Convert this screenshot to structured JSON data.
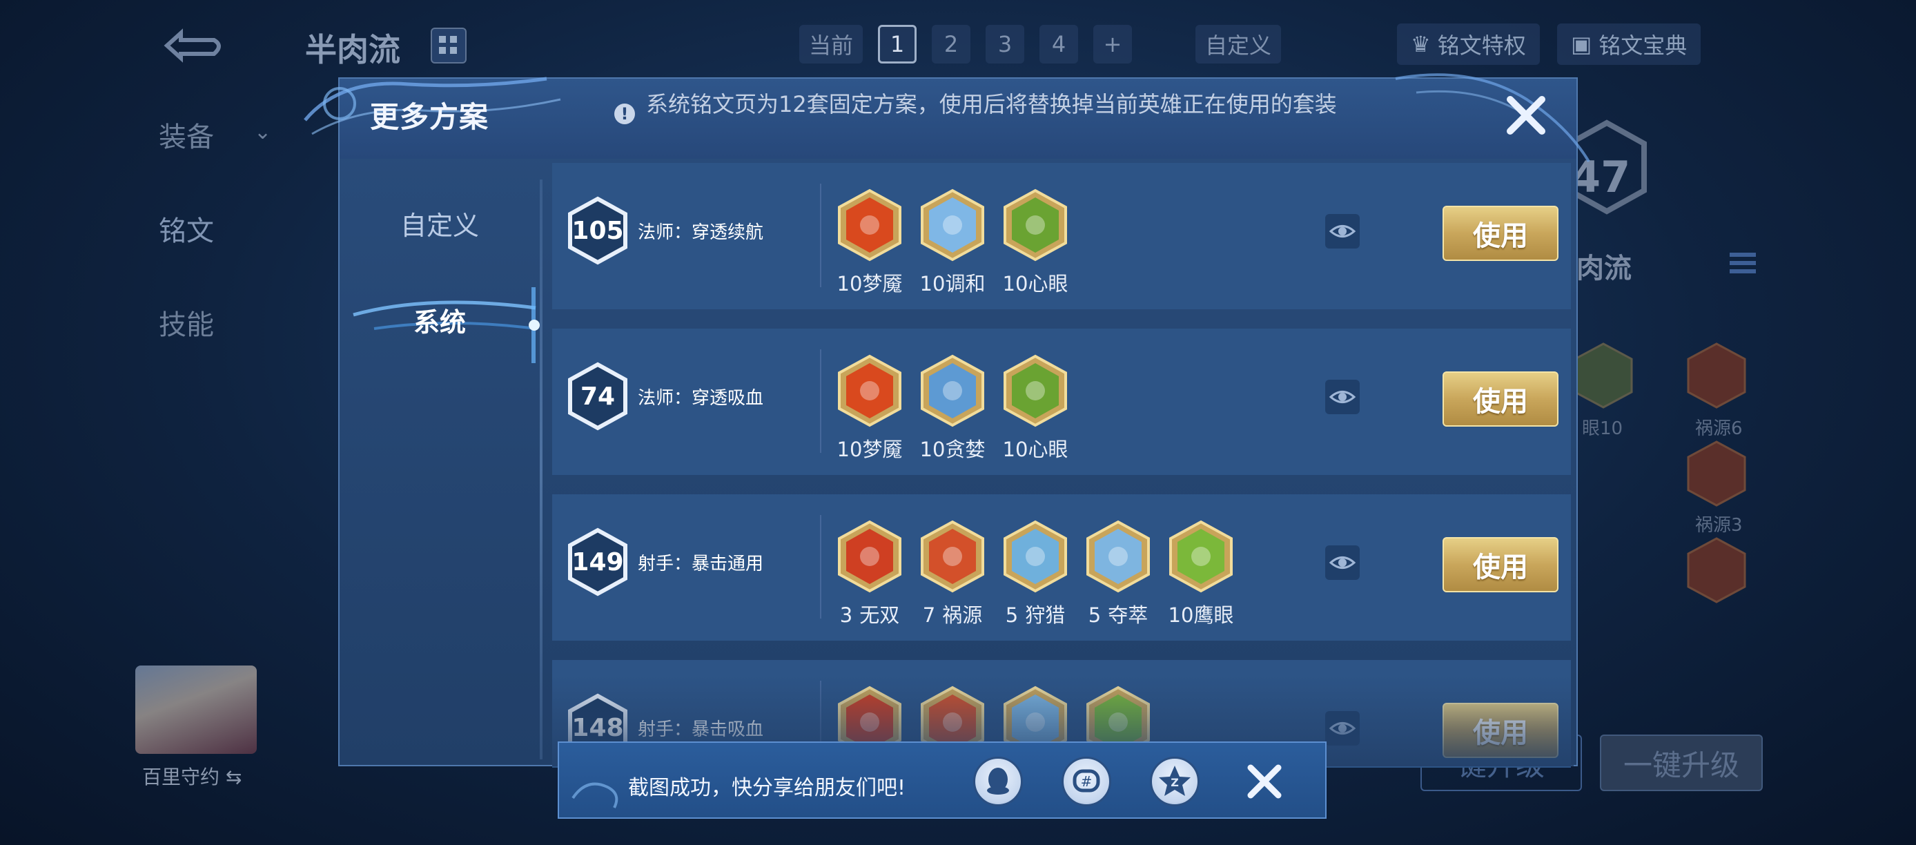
{
  "background": {
    "title": "半肉流",
    "page_tabs": [
      {
        "label": "当前"
      },
      {
        "label": "1",
        "active": true
      },
      {
        "label": "2"
      },
      {
        "label": "3"
      },
      {
        "label": "4"
      },
      {
        "label": "+"
      },
      {
        "label": "自定义"
      }
    ],
    "rune_privilege": "铭文特权",
    "rune_book": "铭文宝典",
    "side_nav": [
      "装备",
      "铭文",
      "技能"
    ],
    "level": "47",
    "set_name": "肉流",
    "rune_labels": [
      "眼10",
      "祸源6",
      "祸源3"
    ],
    "hero_name": "百里守约",
    "upgrade_page": "键升级",
    "one_click_upgrade": "一键升级"
  },
  "modal": {
    "title": "更多方案",
    "notice": "系统铭文页为12套固定方案，使用后将替换掉当前英雄正在使用的套装",
    "nav": {
      "custom": "自定义",
      "system": "系统"
    },
    "use_label": "使用",
    "presets": [
      {
        "level": "105",
        "name": "法师：穿透续航",
        "runes": [
          {
            "count": "10",
            "name": "梦魇",
            "color": "#d9491e"
          },
          {
            "count": "10",
            "name": "调和",
            "color": "#7fb7e6"
          },
          {
            "count": "10",
            "name": "心眼",
            "color": "#6aa332"
          }
        ]
      },
      {
        "level": "74",
        "name": "法师：穿透吸血",
        "runes": [
          {
            "count": "10",
            "name": "梦魇",
            "color": "#d9491e"
          },
          {
            "count": "10",
            "name": "贪婪",
            "color": "#5d9ad3"
          },
          {
            "count": "10",
            "name": "心眼",
            "color": "#6aa332"
          }
        ]
      },
      {
        "level": "149",
        "name": "射手：暴击通用",
        "runes": [
          {
            "count": "3",
            "name": "无双",
            "color": "#cf3f22"
          },
          {
            "count": "7",
            "name": "祸源",
            "color": "#d3502a"
          },
          {
            "count": "5",
            "name": "狩猎",
            "color": "#6fb0dc"
          },
          {
            "count": "5",
            "name": "夺萃",
            "color": "#7eb5e0"
          },
          {
            "count": "10",
            "name": "鹰眼",
            "color": "#7bb83a"
          }
        ]
      },
      {
        "level": "148",
        "name": "射手：暴击吸血",
        "runes": [
          {
            "count": "",
            "name": "",
            "color": "#cf3f22"
          },
          {
            "count": "",
            "name": "",
            "color": "#d3502a"
          },
          {
            "count": "",
            "name": "",
            "color": "#7eb5e0"
          },
          {
            "count": "",
            "name": "",
            "color": "#7bb83a"
          }
        ]
      }
    ]
  },
  "toast": {
    "message": "截图成功，快分享给朋友们吧!",
    "share_targets": [
      "qq-icon",
      "wechat-moments-icon",
      "qzone-icon"
    ]
  },
  "colors": {
    "gold": "#c9a65b",
    "panel": "#2d5486",
    "accent": "#5d8fd0"
  }
}
